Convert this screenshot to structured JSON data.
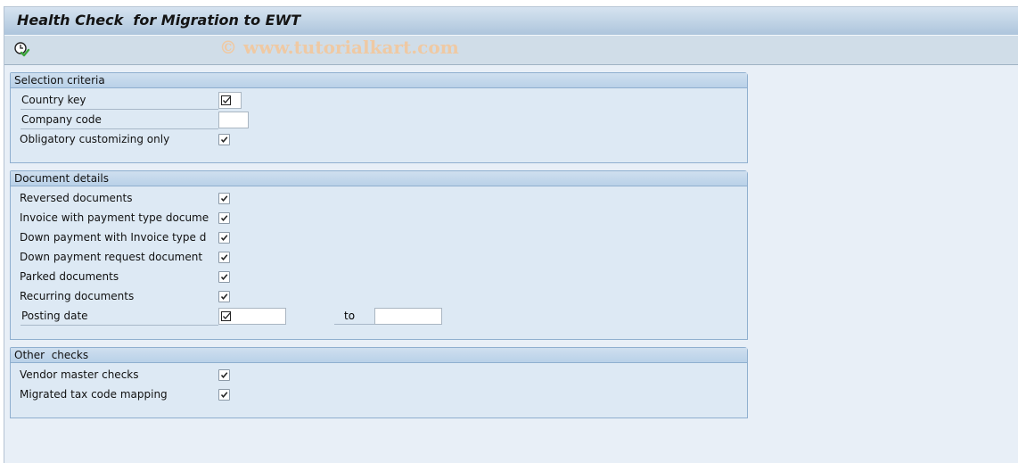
{
  "window": {
    "title": "Health Check  for Migration to EWT",
    "watermark": "© www.tutorialkart.com"
  },
  "toolbar": {
    "execute_icon": "execute-clock-check-icon"
  },
  "groups": {
    "selection": {
      "title": "Selection criteria",
      "country_key": {
        "label": "Country key",
        "value": "",
        "required_marker": true
      },
      "company_code": {
        "label": "Company code",
        "value": ""
      },
      "obligatory_only": {
        "label": "Obligatory customizing only",
        "checked": true
      }
    },
    "document": {
      "title": "Document details",
      "items": [
        {
          "label": "Reversed documents",
          "checked": true
        },
        {
          "label": "Invoice with payment type docume",
          "checked": true
        },
        {
          "label": "Down payment with Invoice type d",
          "checked": true
        },
        {
          "label": "Down payment request document",
          "checked": true
        },
        {
          "label": "Parked documents",
          "checked": true
        },
        {
          "label": "Recurring documents",
          "checked": true
        }
      ],
      "posting_date": {
        "label": "Posting date",
        "from": "",
        "to_label": "to",
        "to": "",
        "required_marker": true
      }
    },
    "other": {
      "title": "Other  checks",
      "items": [
        {
          "label": "Vendor master checks",
          "checked": true
        },
        {
          "label": "Migrated tax code mapping",
          "checked": true
        }
      ]
    }
  }
}
